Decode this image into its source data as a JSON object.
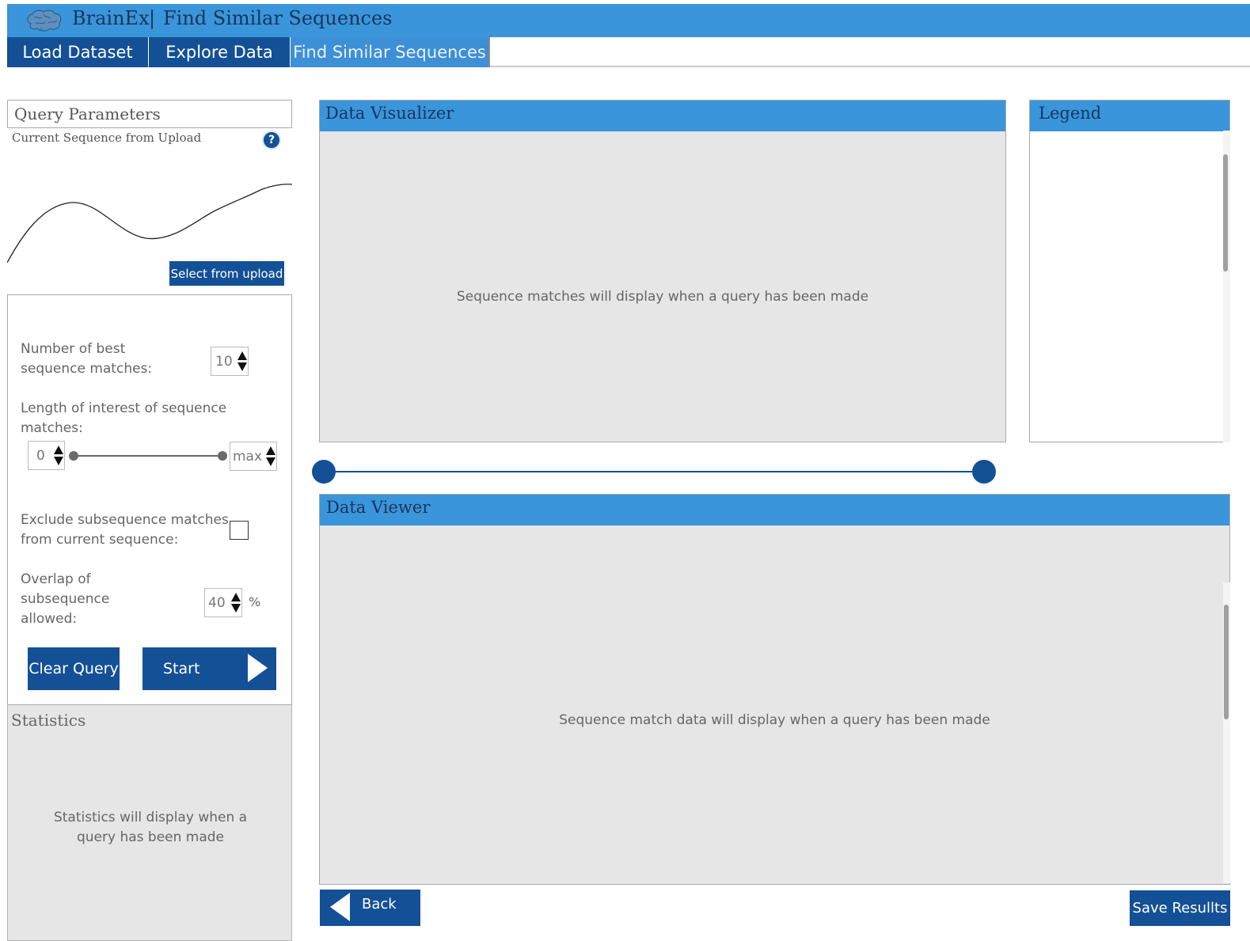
{
  "app": {
    "name": "BrainEx",
    "separator": "|",
    "page_heading": "Find Similar Sequences",
    "brand_color": "#3a95da",
    "dark_color": "#145096",
    "logo_icon": "brain-icon"
  },
  "tabs": [
    {
      "label": "Load Dataset",
      "active": false
    },
    {
      "label": "Explore Data",
      "active": false
    },
    {
      "label": "Find Similar Sequences",
      "active": true
    }
  ],
  "query": {
    "title": "Query Parameters",
    "current_sequence_label": "Current Sequence from Upload",
    "help_icon": "?",
    "select_button": "Select from upload",
    "best_matches_label": "Number of best sequence matches:",
    "best_matches_value": "10",
    "length_label": "Length of interest of sequence matches:",
    "length_min": "0",
    "length_max": "max",
    "exclude_label": "Exclude subsequence matches from current sequence:",
    "exclude_checked": false,
    "overlap_label": "Overlap of subsequence allowed:",
    "overlap_value": "40",
    "overlap_unit": "%",
    "clear_button": "Clear Query",
    "start_button": "Start"
  },
  "statistics": {
    "title": "Statistics",
    "message": "Statistics will display when a query has been made"
  },
  "visualizer": {
    "title": "Data Visualizer",
    "message": "Sequence matches will display when a query has been made"
  },
  "legend": {
    "title": "Legend"
  },
  "viewer": {
    "title": "Data Viewer",
    "message": "Sequence match data will display when a query has been made"
  },
  "footer": {
    "back_button": "Back",
    "save_button": "Save Resullts"
  }
}
